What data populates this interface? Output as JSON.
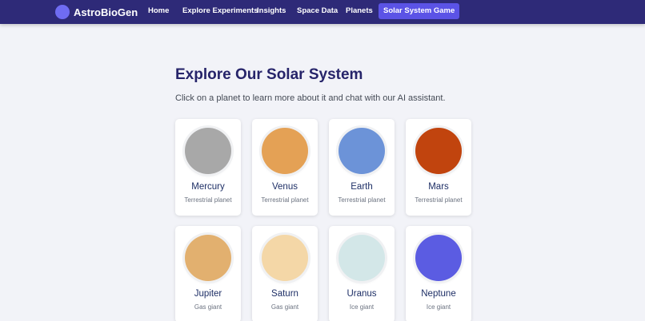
{
  "brand": {
    "name": "AstroBioGen",
    "logo_color": "#6f6cf2"
  },
  "nav": {
    "items": [
      {
        "label": "Home"
      },
      {
        "label": "Explore Experiments"
      },
      {
        "label": "Insights"
      },
      {
        "label": "Space Data"
      },
      {
        "label": "Planets"
      },
      {
        "label": "Solar System Game",
        "active": true
      }
    ]
  },
  "main": {
    "title": "Explore Our Solar System",
    "subtitle": "Click on a planet to learn more about it and chat with our AI assistant."
  },
  "planets": [
    {
      "name": "Mercury",
      "type": "Terrestrial planet",
      "color": "#a8a8a8"
    },
    {
      "name": "Venus",
      "type": "Terrestrial planet",
      "color": "#e4a155"
    },
    {
      "name": "Earth",
      "type": "Terrestrial planet",
      "color": "#6c93d8"
    },
    {
      "name": "Mars",
      "type": "Terrestrial planet",
      "color": "#c1440e"
    },
    {
      "name": "Jupiter",
      "type": "Gas giant",
      "color": "#e2b06f"
    },
    {
      "name": "Saturn",
      "type": "Gas giant",
      "color": "#f4d7a7"
    },
    {
      "name": "Uranus",
      "type": "Ice giant",
      "color": "#d3e7e8"
    },
    {
      "name": "Neptune",
      "type": "Ice giant",
      "color": "#5b5ce2"
    }
  ],
  "colors": {
    "navbar": "#2e2a78",
    "nav_active": "#5b53e6",
    "title": "#26246a",
    "background": "#f2f3f8"
  }
}
